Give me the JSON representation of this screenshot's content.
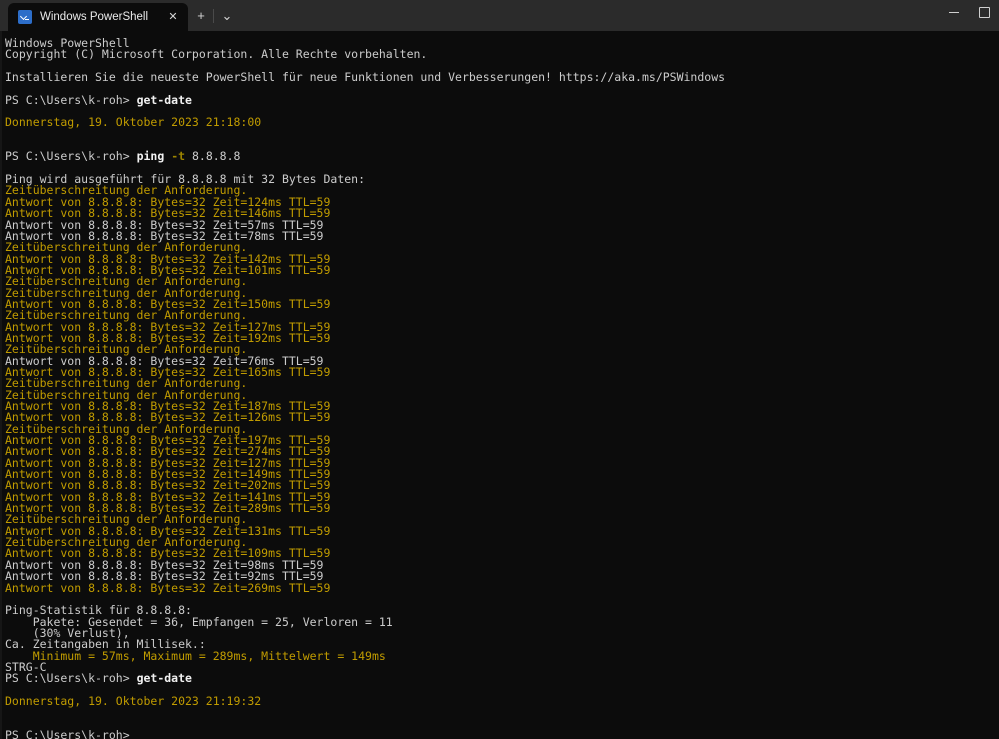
{
  "window": {
    "title": "Windows PowerShell",
    "tab_icon": "powershell-icon",
    "close_label": "✕",
    "new_tab_label": "+",
    "tab_menu_label": "⌄",
    "minimize_label": "minimize-icon",
    "maximize_label": "maximize-icon"
  },
  "colors": {
    "background": "#0c0c0c",
    "chrome": "#2b2b2b",
    "text": "#cccccc",
    "yellow": "#c19c00",
    "bold_white": "#f2f2f2",
    "param": "#9c8400",
    "tab_accent": "#2d6ec9"
  },
  "console": {
    "prompt": "PS C:\\Users\\k-roh>",
    "lines": [
      {
        "type": "text",
        "color": "white",
        "text": "Windows PowerShell"
      },
      {
        "type": "text",
        "color": "white",
        "text": "Copyright (C) Microsoft Corporation. Alle Rechte vorbehalten."
      },
      {
        "type": "blank"
      },
      {
        "type": "text",
        "color": "white",
        "text": "Installieren Sie die neueste PowerShell für neue Funktionen und Verbesserungen! https://aka.ms/PSWindows"
      },
      {
        "type": "blank"
      },
      {
        "type": "command",
        "prompt": "PS C:\\Users\\k-roh> ",
        "cmd": "get-date",
        "args": ""
      },
      {
        "type": "blank"
      },
      {
        "type": "text",
        "color": "yellow",
        "text": "Donnerstag, 19. Oktober 2023 21:18:00"
      },
      {
        "type": "blank"
      },
      {
        "type": "blank"
      },
      {
        "type": "command",
        "prompt": "PS C:\\Users\\k-roh> ",
        "cmd": "ping ",
        "param": "-t",
        "args": " 8.8.8.8"
      },
      {
        "type": "blank"
      },
      {
        "type": "text",
        "color": "white",
        "text": "Ping wird ausgeführt für 8.8.8.8 mit 32 Bytes Daten:"
      },
      {
        "type": "text",
        "color": "yellow",
        "text": "Zeitüberschreitung der Anforderung."
      },
      {
        "type": "text",
        "color": "yellow",
        "text": "Antwort von 8.8.8.8: Bytes=32 Zeit=124ms TTL=59"
      },
      {
        "type": "text",
        "color": "yellow",
        "text": "Antwort von 8.8.8.8: Bytes=32 Zeit=146ms TTL=59"
      },
      {
        "type": "text",
        "color": "white",
        "text": "Antwort von 8.8.8.8: Bytes=32 Zeit=57ms TTL=59"
      },
      {
        "type": "text",
        "color": "white",
        "text": "Antwort von 8.8.8.8: Bytes=32 Zeit=78ms TTL=59"
      },
      {
        "type": "text",
        "color": "yellow",
        "text": "Zeitüberschreitung der Anforderung."
      },
      {
        "type": "text",
        "color": "yellow",
        "text": "Antwort von 8.8.8.8: Bytes=32 Zeit=142ms TTL=59"
      },
      {
        "type": "text",
        "color": "yellow",
        "text": "Antwort von 8.8.8.8: Bytes=32 Zeit=101ms TTL=59"
      },
      {
        "type": "text",
        "color": "yellow",
        "text": "Zeitüberschreitung der Anforderung."
      },
      {
        "type": "text",
        "color": "yellow",
        "text": "Zeitüberschreitung der Anforderung."
      },
      {
        "type": "text",
        "color": "yellow",
        "text": "Antwort von 8.8.8.8: Bytes=32 Zeit=150ms TTL=59"
      },
      {
        "type": "text",
        "color": "yellow",
        "text": "Zeitüberschreitung der Anforderung."
      },
      {
        "type": "text",
        "color": "yellow",
        "text": "Antwort von 8.8.8.8: Bytes=32 Zeit=127ms TTL=59"
      },
      {
        "type": "text",
        "color": "yellow",
        "text": "Antwort von 8.8.8.8: Bytes=32 Zeit=192ms TTL=59"
      },
      {
        "type": "text",
        "color": "yellow",
        "text": "Zeitüberschreitung der Anforderung."
      },
      {
        "type": "text",
        "color": "white",
        "text": "Antwort von 8.8.8.8: Bytes=32 Zeit=76ms TTL=59"
      },
      {
        "type": "text",
        "color": "yellow",
        "text": "Antwort von 8.8.8.8: Bytes=32 Zeit=165ms TTL=59"
      },
      {
        "type": "text",
        "color": "yellow",
        "text": "Zeitüberschreitung der Anforderung."
      },
      {
        "type": "text",
        "color": "yellow",
        "text": "Zeitüberschreitung der Anforderung."
      },
      {
        "type": "text",
        "color": "yellow",
        "text": "Antwort von 8.8.8.8: Bytes=32 Zeit=187ms TTL=59"
      },
      {
        "type": "text",
        "color": "yellow",
        "text": "Antwort von 8.8.8.8: Bytes=32 Zeit=126ms TTL=59"
      },
      {
        "type": "text",
        "color": "yellow",
        "text": "Zeitüberschreitung der Anforderung."
      },
      {
        "type": "text",
        "color": "yellow",
        "text": "Antwort von 8.8.8.8: Bytes=32 Zeit=197ms TTL=59"
      },
      {
        "type": "text",
        "color": "yellow",
        "text": "Antwort von 8.8.8.8: Bytes=32 Zeit=274ms TTL=59"
      },
      {
        "type": "text",
        "color": "yellow",
        "text": "Antwort von 8.8.8.8: Bytes=32 Zeit=127ms TTL=59"
      },
      {
        "type": "text",
        "color": "yellow",
        "text": "Antwort von 8.8.8.8: Bytes=32 Zeit=149ms TTL=59"
      },
      {
        "type": "text",
        "color": "yellow",
        "text": "Antwort von 8.8.8.8: Bytes=32 Zeit=202ms TTL=59"
      },
      {
        "type": "text",
        "color": "yellow",
        "text": "Antwort von 8.8.8.8: Bytes=32 Zeit=141ms TTL=59"
      },
      {
        "type": "text",
        "color": "yellow",
        "text": "Antwort von 8.8.8.8: Bytes=32 Zeit=289ms TTL=59"
      },
      {
        "type": "text",
        "color": "yellow",
        "text": "Zeitüberschreitung der Anforderung."
      },
      {
        "type": "text",
        "color": "yellow",
        "text": "Antwort von 8.8.8.8: Bytes=32 Zeit=131ms TTL=59"
      },
      {
        "type": "text",
        "color": "yellow",
        "text": "Zeitüberschreitung der Anforderung."
      },
      {
        "type": "text",
        "color": "yellow",
        "text": "Antwort von 8.8.8.8: Bytes=32 Zeit=109ms TTL=59"
      },
      {
        "type": "text",
        "color": "white",
        "text": "Antwort von 8.8.8.8: Bytes=32 Zeit=98ms TTL=59"
      },
      {
        "type": "text",
        "color": "white",
        "text": "Antwort von 8.8.8.8: Bytes=32 Zeit=92ms TTL=59"
      },
      {
        "type": "text",
        "color": "yellow",
        "text": "Antwort von 8.8.8.8: Bytes=32 Zeit=269ms TTL=59"
      },
      {
        "type": "blank"
      },
      {
        "type": "text",
        "color": "white",
        "text": "Ping-Statistik für 8.8.8.8:"
      },
      {
        "type": "text",
        "color": "white",
        "text": "    Pakete: Gesendet = 36, Empfangen = 25, Verloren = 11"
      },
      {
        "type": "text",
        "color": "white",
        "text": "    (30% Verlust),"
      },
      {
        "type": "text",
        "color": "white",
        "text": "Ca. Zeitangaben in Millisek.:"
      },
      {
        "type": "text",
        "color": "yellow",
        "text": "    Minimum = 57ms, Maximum = 289ms, Mittelwert = 149ms"
      },
      {
        "type": "text",
        "color": "white",
        "text": "STRG-C"
      },
      {
        "type": "command",
        "prompt": "PS C:\\Users\\k-roh> ",
        "cmd": "get-date",
        "args": ""
      },
      {
        "type": "blank"
      },
      {
        "type": "text",
        "color": "yellow",
        "text": "Donnerstag, 19. Oktober 2023 21:19:32"
      },
      {
        "type": "blank"
      },
      {
        "type": "blank"
      },
      {
        "type": "command",
        "prompt": "PS C:\\Users\\k-roh>",
        "cmd": "",
        "args": ""
      }
    ]
  }
}
